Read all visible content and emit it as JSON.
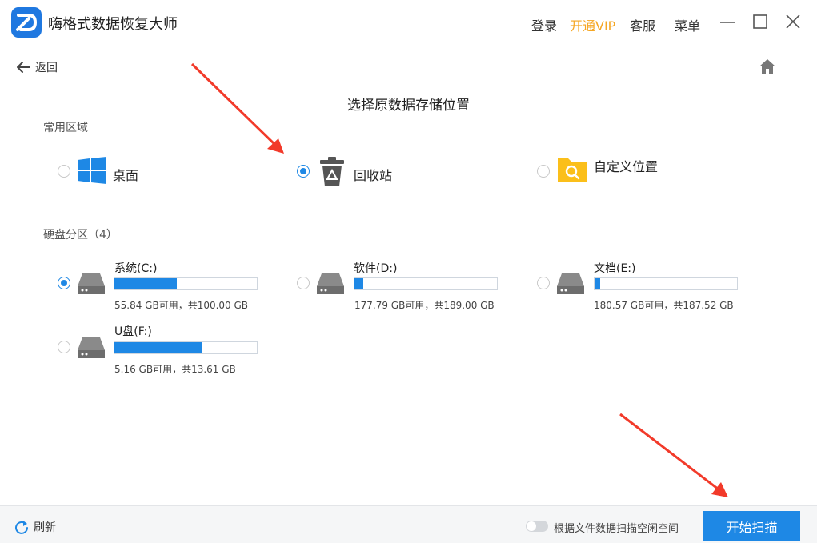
{
  "app": {
    "title": "嗨格式数据恢复大师",
    "menu": {
      "login": "登录",
      "vip": "开通VIP",
      "service": "客服",
      "menu": "菜单"
    }
  },
  "nav": {
    "back": "返回"
  },
  "page": {
    "title": "选择原数据存储位置"
  },
  "common": {
    "label": "常用区域",
    "items": [
      {
        "label": "桌面",
        "checked": false,
        "icon": "windows-icon"
      },
      {
        "label": "回收站",
        "checked": true,
        "icon": "recycle-bin-icon"
      },
      {
        "label": "自定义位置",
        "checked": false,
        "icon": "folder-search-icon"
      }
    ]
  },
  "drives": {
    "label": "硬盘分区（4）",
    "items": [
      {
        "name": "系统(C:)",
        "capacity": "55.84 GB可用，共100.00 GB",
        "used_fraction": 0.44,
        "checked": true
      },
      {
        "name": "软件(D:)",
        "capacity": "177.79 GB可用，共189.00 GB",
        "used_fraction": 0.06,
        "checked": false
      },
      {
        "name": "文档(E:)",
        "capacity": "180.57 GB可用，共187.52 GB",
        "used_fraction": 0.04,
        "checked": false
      },
      {
        "name": "U盘(F:)",
        "capacity": "5.16 GB可用，共13.61 GB",
        "used_fraction": 0.62,
        "checked": false
      }
    ]
  },
  "footer": {
    "refresh": "刷新",
    "toggle_label": "根据文件数据扫描空闲空间",
    "toggle_on": false,
    "start": "开始扫描"
  },
  "colors": {
    "accent": "#1e88e5",
    "vip": "#f5a623",
    "arrow": "#f23a2a"
  }
}
